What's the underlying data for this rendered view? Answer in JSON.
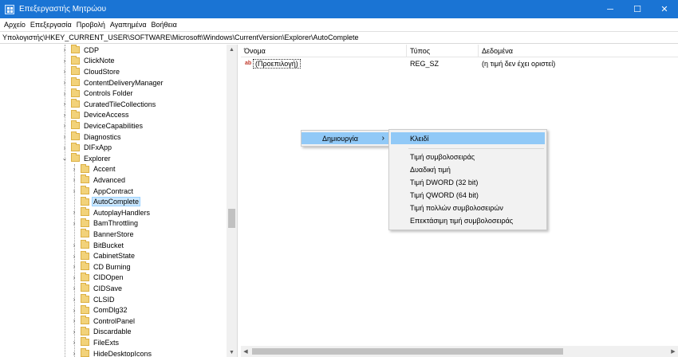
{
  "window": {
    "title": "Επεξεργαστής Μητρώου",
    "controls": {
      "minimize": "─",
      "maximize": "☐",
      "close": "✕"
    }
  },
  "menu": [
    "Αρχείο",
    "Επεξεργασία",
    "Προβολή",
    "Αγαπημένα",
    "Βοήθεια"
  ],
  "address": "Υπολογιστής\\HKEY_CURRENT_USER\\SOFTWARE\\Microsoft\\Windows\\CurrentVersion\\Explorer\\AutoComplete",
  "tree": {
    "items": [
      {
        "label": "CDP",
        "level": 0,
        "toggle": "›"
      },
      {
        "label": "ClickNote",
        "level": 0,
        "toggle": "›"
      },
      {
        "label": "CloudStore",
        "level": 0,
        "toggle": "›"
      },
      {
        "label": "ContentDeliveryManager",
        "level": 0,
        "toggle": "›"
      },
      {
        "label": "Controls Folder",
        "level": 0,
        "toggle": "›"
      },
      {
        "label": "CuratedTileCollections",
        "level": 0,
        "toggle": "›"
      },
      {
        "label": "DeviceAccess",
        "level": 0,
        "toggle": "›"
      },
      {
        "label": "DeviceCapabilities",
        "level": 0,
        "toggle": "›"
      },
      {
        "label": "Diagnostics",
        "level": 0,
        "toggle": "›"
      },
      {
        "label": "DIFxApp",
        "level": 0,
        "toggle": "›"
      },
      {
        "label": "Explorer",
        "level": 0,
        "toggle": "⌄"
      },
      {
        "label": "Accent",
        "level": 1,
        "toggle": "›"
      },
      {
        "label": "Advanced",
        "level": 1,
        "toggle": "›"
      },
      {
        "label": "AppContract",
        "level": 1,
        "toggle": "›"
      },
      {
        "label": "AutoComplete",
        "level": 1,
        "toggle": "",
        "selected": true
      },
      {
        "label": "AutoplayHandlers",
        "level": 1,
        "toggle": "›"
      },
      {
        "label": "BamThrottling",
        "level": 1,
        "toggle": "›"
      },
      {
        "label": "BannerStore",
        "level": 1,
        "toggle": ""
      },
      {
        "label": "BitBucket",
        "level": 1,
        "toggle": "›"
      },
      {
        "label": "CabinetState",
        "level": 1,
        "toggle": "›"
      },
      {
        "label": "CD Burning",
        "level": 1,
        "toggle": "›"
      },
      {
        "label": "CIDOpen",
        "level": 1,
        "toggle": "›"
      },
      {
        "label": "CIDSave",
        "level": 1,
        "toggle": "›"
      },
      {
        "label": "CLSID",
        "level": 1,
        "toggle": "›"
      },
      {
        "label": "ComDlg32",
        "level": 1,
        "toggle": "›"
      },
      {
        "label": "ControlPanel",
        "level": 1,
        "toggle": "›"
      },
      {
        "label": "Discardable",
        "level": 1,
        "toggle": "›"
      },
      {
        "label": "FileExts",
        "level": 1,
        "toggle": "›"
      },
      {
        "label": "HideDesktopIcons",
        "level": 1,
        "toggle": "›"
      }
    ]
  },
  "list": {
    "columns": {
      "name": "Όνομα",
      "type": "Τύπος",
      "data": "Δεδομένα"
    },
    "rows": [
      {
        "name": "(Προεπιλογή)",
        "type": "REG_SZ",
        "data": "(η τιμή δεν έχει οριστεί)",
        "icon": "ab"
      }
    ]
  },
  "context_menu": {
    "parent": {
      "label": "Δημιουργία",
      "arrow": "›"
    },
    "submenu": [
      "Κλειδί",
      "Τιμή συμβολοσειράς",
      "Δυαδική τιμή",
      "Τιμή DWORD (32 bit)",
      "Τιμή QWORD (64 bit)",
      "Τιμή πολλών συμβολοσειρών",
      "Επεκτάσιμη τιμή συμβολοσειράς"
    ]
  },
  "scroll_arrows": {
    "up": "▲",
    "down": "▼",
    "left": "◀",
    "right": "▶"
  }
}
